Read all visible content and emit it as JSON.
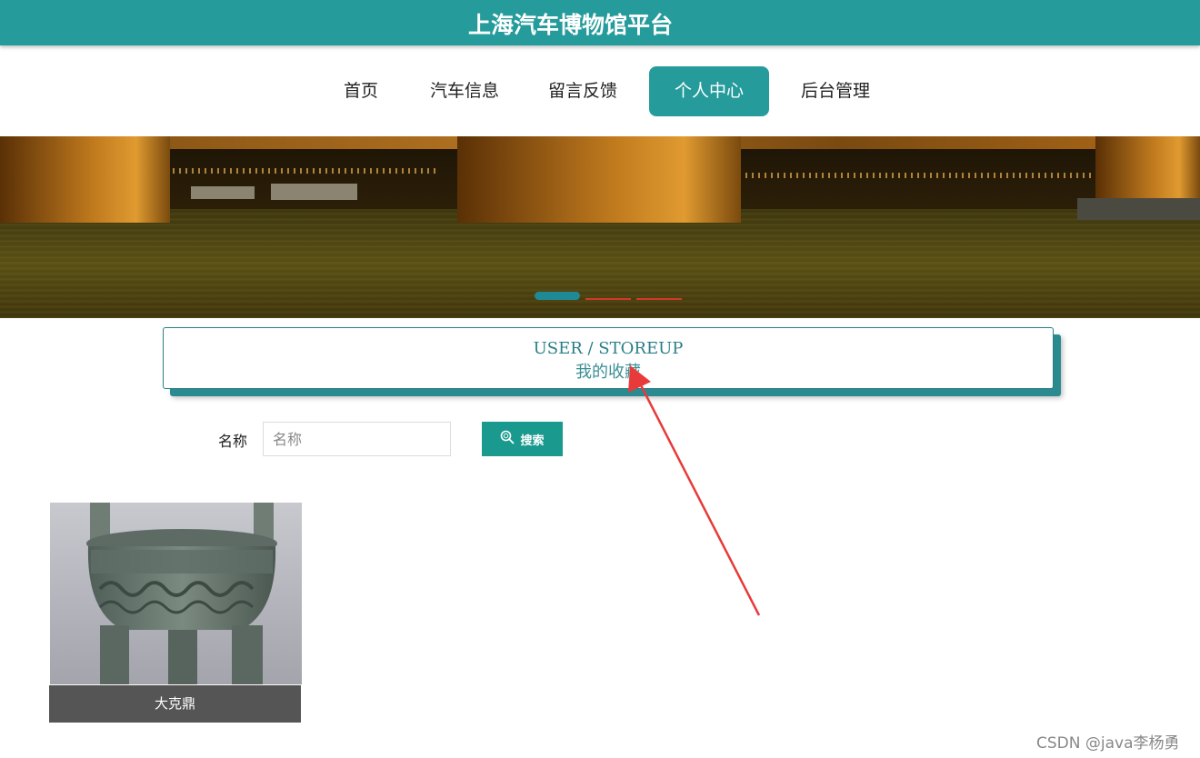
{
  "header": {
    "title": "上海汽车博物馆平台"
  },
  "nav": {
    "items": [
      {
        "label": "首页"
      },
      {
        "label": "汽车信息"
      },
      {
        "label": "留言反馈"
      },
      {
        "label": "个人中心",
        "active": true
      },
      {
        "label": "后台管理"
      }
    ]
  },
  "carousel": {
    "slide_count": 3,
    "active_index": 0
  },
  "section": {
    "title_en": "USER / STOREUP",
    "title_cn": "我的收藏"
  },
  "search": {
    "label": "名称",
    "placeholder": "名称",
    "value": "",
    "button_label": "搜索"
  },
  "favorites": [
    {
      "name": "大克鼎"
    }
  ],
  "watermark": "CSDN @java李杨勇",
  "colors": {
    "primary": "#259b9b",
    "button": "#1a9a8e",
    "annotation_arrow": "#e83a3a"
  }
}
